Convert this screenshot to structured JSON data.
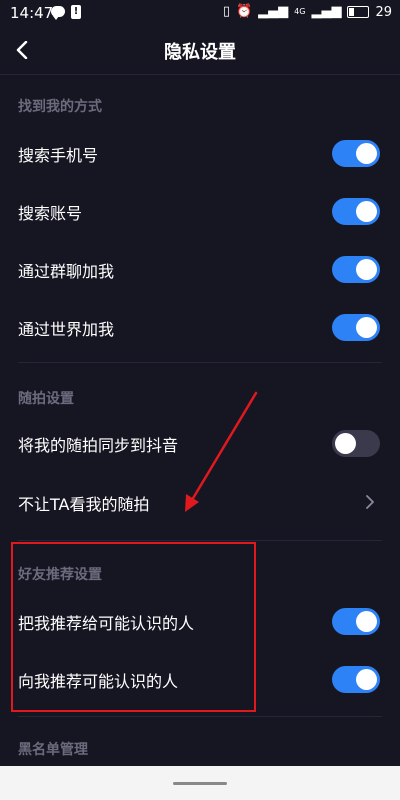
{
  "status_bar": {
    "time": "14:47",
    "battery": "29",
    "network_label": "4G"
  },
  "header": {
    "title": "隐私设置"
  },
  "sections": {
    "find_me": {
      "title": "找到我的方式",
      "items": [
        {
          "label": "搜索手机号",
          "enabled": true
        },
        {
          "label": "搜索账号",
          "enabled": true
        },
        {
          "label": "通过群聊加我",
          "enabled": true
        },
        {
          "label": "通过世界加我",
          "enabled": true
        }
      ]
    },
    "snapshot": {
      "title": "随拍设置",
      "sync_label": "将我的随拍同步到抖音",
      "sync_enabled": false,
      "hide_label": "不让TA看我的随拍"
    },
    "friend_rec": {
      "title": "好友推荐设置",
      "items": [
        {
          "label": "把我推荐给可能认识的人",
          "enabled": true
        },
        {
          "label": "向我推荐可能认识的人",
          "enabled": true
        }
      ]
    },
    "blacklist": {
      "title": "黑名单管理"
    }
  },
  "colors": {
    "background": "#161623",
    "toggle_on": "#2d82f5",
    "toggle_off": "#3a3a4c",
    "annotation": "#e0191f",
    "section_title": "#6b6b7e"
  },
  "icons": {
    "back": "back-arrow-icon",
    "chevron": "chevron-right-icon"
  }
}
